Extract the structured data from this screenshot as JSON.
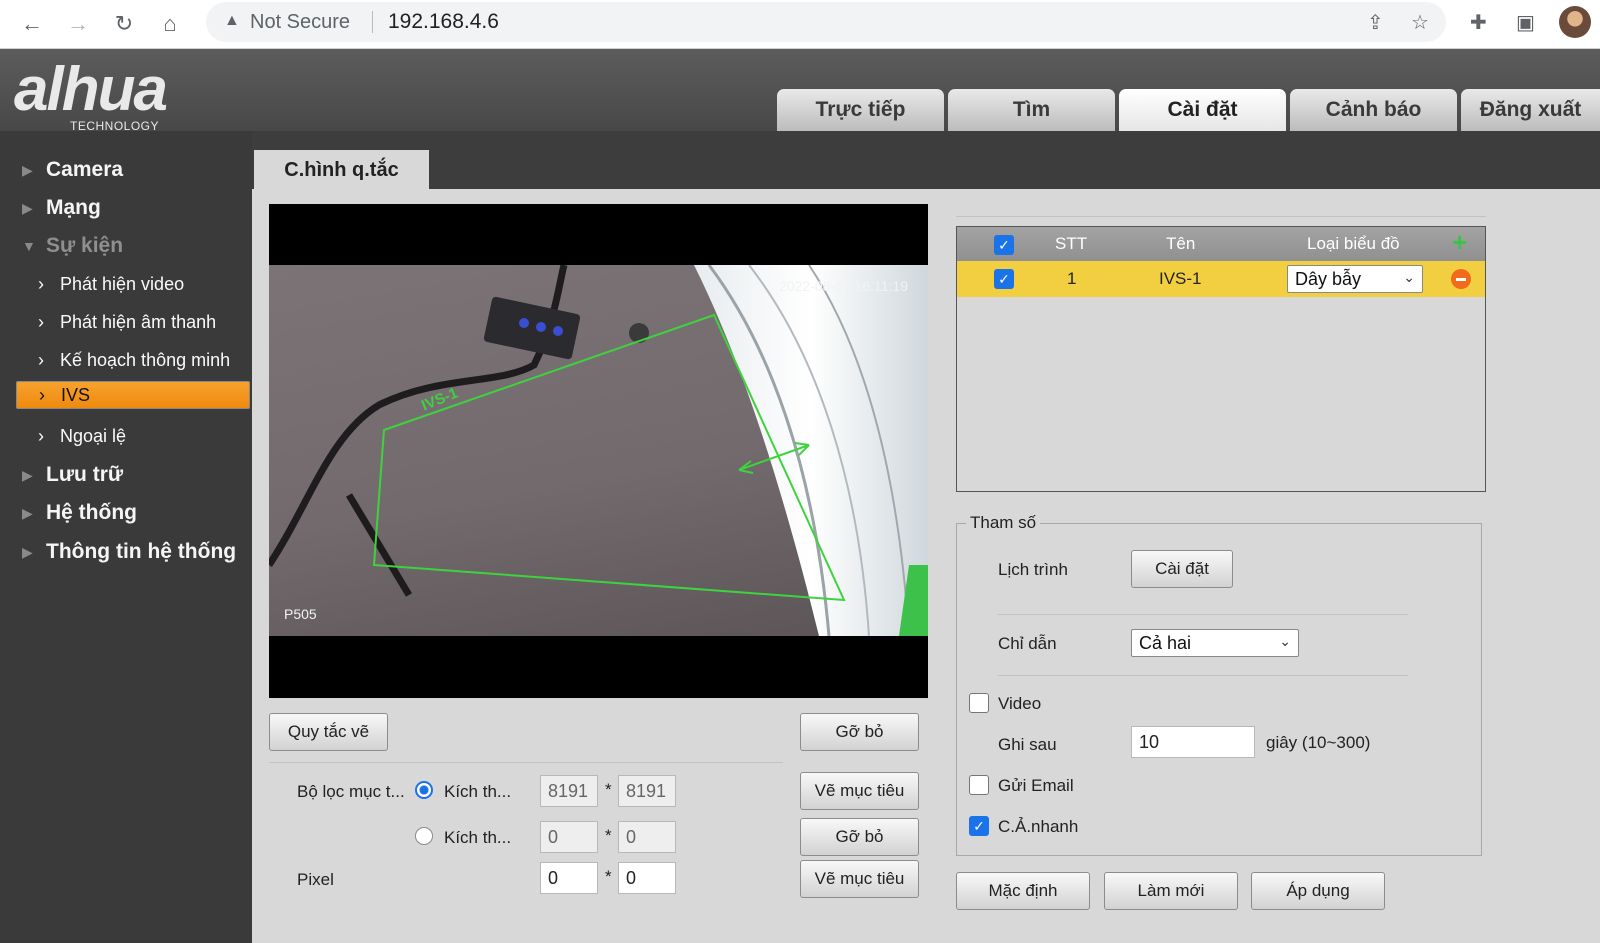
{
  "browser": {
    "security_label": "Not Secure",
    "url": "192.168.4.6"
  },
  "header": {
    "logo": "alhua",
    "logo_sub": "TECHNOLOGY",
    "tabs": [
      "Trực tiếp",
      "Tìm",
      "Cài đặt",
      "Cảnh báo",
      "Đăng xuất"
    ],
    "active_tab": "Cài đặt"
  },
  "sidebar": {
    "items": [
      "Camera",
      "Mạng",
      "Sự kiện",
      "Lưu trữ",
      "Hệ thống",
      "Thông tin hệ thống"
    ],
    "sub_items": [
      "Phát hiện video",
      "Phát hiện âm thanh",
      "Kế hoạch thông minh",
      "IVS",
      "Ngoại lệ"
    ],
    "selected": "IVS"
  },
  "page": {
    "subtab": "C.hình q.tắc"
  },
  "video": {
    "timestamp": "2022-08-07 16:11:19",
    "camera_name": "P505",
    "rule_label": "IVS-1"
  },
  "controls": {
    "draw_rule": "Quy tắc vẽ",
    "remove": "Gỡ bỏ",
    "draw_target": "Vẽ mục tiêu",
    "filter_label": "Bộ lọc mục t...",
    "size_label": "Kích th...",
    "times": "*",
    "pixel_label": "Pixel",
    "max_w": "8191",
    "max_h": "8191",
    "min_w": "0",
    "min_h": "0",
    "pix_w": "0",
    "pix_h": "0"
  },
  "table": {
    "headers": [
      "STT",
      "Tên",
      "Loại biểu đồ"
    ],
    "rows": [
      {
        "stt": "1",
        "name": "IVS-1",
        "type": "Dây bẫy",
        "checked": true
      }
    ]
  },
  "params": {
    "legend": "Tham số",
    "schedule_label": "Lịch trình",
    "schedule_button": "Cài đặt",
    "direction_label": "Chỉ dẫn",
    "direction_value": "Cả hai",
    "video_label": "Video",
    "record_after_label": "Ghi sau",
    "record_after_value": "10",
    "record_after_unit": "giây (10~300)",
    "email_label": "Gửi Email",
    "snapshot_label": "C.Ả.nhanh",
    "video_checked": false,
    "email_checked": false,
    "snapshot_checked": true
  },
  "footer": {
    "default": "Mặc định",
    "refresh": "Làm mới",
    "apply": "Áp dụng"
  },
  "colors": {
    "accent": "#f09219",
    "row_highlight": "#f2cf40",
    "rule_line": "#3ed33e",
    "checkbox": "#1a73e8"
  }
}
